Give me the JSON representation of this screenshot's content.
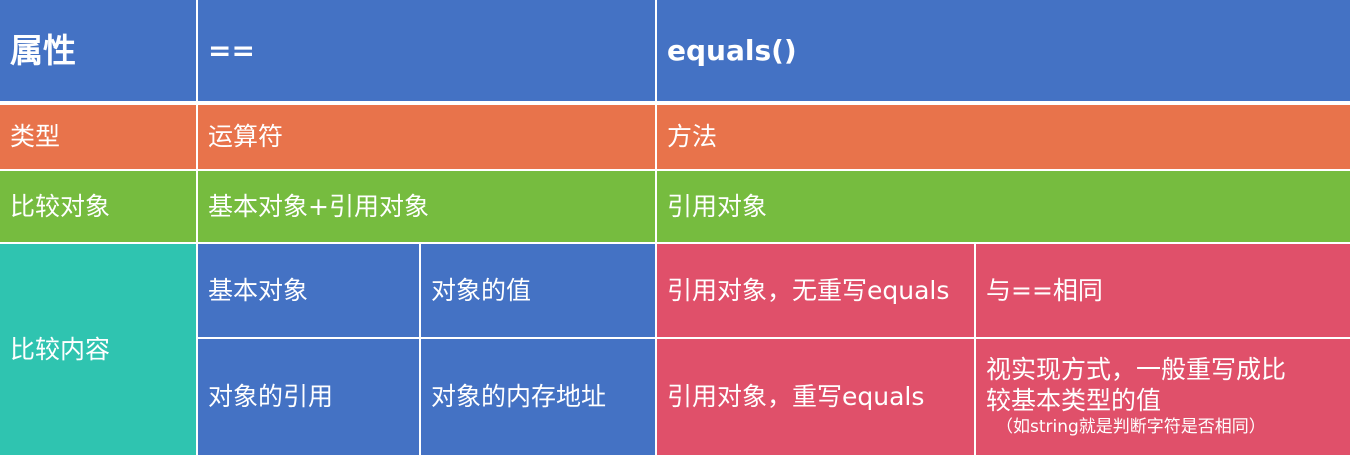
{
  "header": {
    "col1": "属性",
    "col2": "==",
    "col3": "equals()"
  },
  "rows": {
    "type": {
      "label": "类型",
      "op": "运算符",
      "equals": "方法"
    },
    "compare_object": {
      "label": "比较对象",
      "op": "基本对象+引用对象",
      "equals": "引用对象"
    },
    "compare_content": {
      "label": "比较内容",
      "primitive": {
        "kind": "基本对象",
        "value": "对象的值"
      },
      "reference": {
        "kind": "对象的引用",
        "value": "对象的内存地址"
      },
      "no_override": {
        "case": "引用对象，无重写equals",
        "result": "与==相同"
      },
      "override": {
        "case": "引用对象，重写equals",
        "result_line1": "视实现方式，一般重写成比",
        "result_line2": "较基本类型的值",
        "result_note": "（如string就是判断字符是否相同）"
      }
    }
  },
  "colors": {
    "header": "#4472c4",
    "type_row": "#e8734b",
    "object_row": "#76bc3f",
    "content_label": "#2fc4b0",
    "content_op": "#4472c4",
    "content_equals": "#e0506a"
  }
}
